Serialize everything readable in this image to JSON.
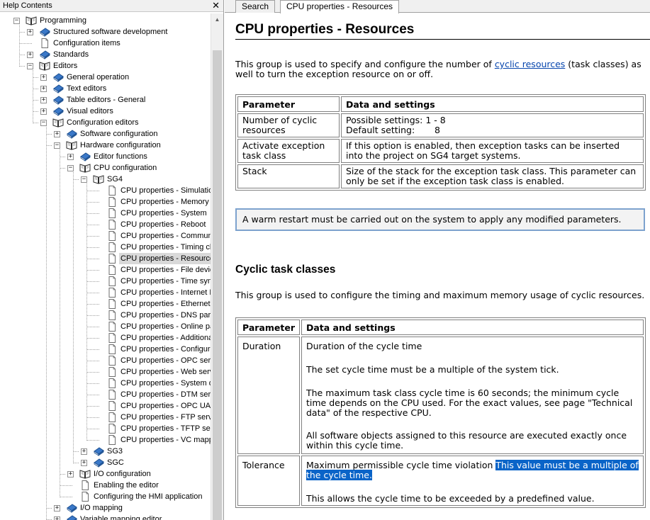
{
  "left_pane": {
    "title": "Help Contents",
    "close": "✕",
    "tree": [
      {
        "label": "Programming",
        "level": 0,
        "icon": "book-open-icon",
        "expander": "minus"
      },
      {
        "label": "Structured software development",
        "level": 1,
        "icon": "book-closed-icon",
        "expander": "plus"
      },
      {
        "label": "Configuration items",
        "level": 1,
        "icon": "page-icon",
        "expander": "none"
      },
      {
        "label": "Standards",
        "level": 1,
        "icon": "book-closed-icon",
        "expander": "plus"
      },
      {
        "label": "Editors",
        "level": 1,
        "icon": "book-open-icon",
        "expander": "minus"
      },
      {
        "label": "General operation",
        "level": 2,
        "icon": "book-closed-icon",
        "expander": "plus"
      },
      {
        "label": "Text editors",
        "level": 2,
        "icon": "book-closed-icon",
        "expander": "plus"
      },
      {
        "label": "Table editors - General",
        "level": 2,
        "icon": "book-closed-icon",
        "expander": "plus"
      },
      {
        "label": "Visual editors",
        "level": 2,
        "icon": "book-closed-icon",
        "expander": "plus"
      },
      {
        "label": "Configuration editors",
        "level": 2,
        "icon": "book-open-icon",
        "expander": "minus"
      },
      {
        "label": "Software configuration",
        "level": 3,
        "icon": "book-closed-icon",
        "expander": "plus"
      },
      {
        "label": "Hardware configuration",
        "level": 3,
        "icon": "book-open-icon",
        "expander": "minus"
      },
      {
        "label": "Editor functions",
        "level": 4,
        "icon": "book-closed-icon",
        "expander": "plus"
      },
      {
        "label": "CPU configuration",
        "level": 4,
        "icon": "book-open-icon",
        "expander": "minus"
      },
      {
        "label": "SG4",
        "level": 5,
        "icon": "book-open-icon",
        "expander": "minus"
      },
      {
        "label": "CPU properties - Simulation",
        "level": 6,
        "icon": "page-icon",
        "expander": "none"
      },
      {
        "label": "CPU properties - Memory",
        "level": 6,
        "icon": "page-icon",
        "expander": "none"
      },
      {
        "label": "CPU properties - System",
        "level": 6,
        "icon": "page-icon",
        "expander": "none"
      },
      {
        "label": "CPU properties - Reboot",
        "level": 6,
        "icon": "page-icon",
        "expander": "none"
      },
      {
        "label": "CPU properties - Communicatio",
        "level": 6,
        "icon": "page-icon",
        "expander": "none"
      },
      {
        "label": "CPU properties - Timing chara",
        "level": 6,
        "icon": "page-icon",
        "expander": "none"
      },
      {
        "label": "CPU properties - Resources",
        "level": 6,
        "icon": "page-icon",
        "expander": "none",
        "selected": true
      },
      {
        "label": "CPU properties - File devices",
        "level": 6,
        "icon": "page-icon",
        "expander": "none"
      },
      {
        "label": "CPU properties - Time synchro",
        "level": 6,
        "icon": "page-icon",
        "expander": "none"
      },
      {
        "label": "CPU properties - Internet File S",
        "level": 6,
        "icon": "page-icon",
        "expander": "none"
      },
      {
        "label": "CPU properties - Ethernet para",
        "level": 6,
        "icon": "page-icon",
        "expander": "none"
      },
      {
        "label": "CPU properties - DNS paramet",
        "level": 6,
        "icon": "page-icon",
        "expander": "none"
      },
      {
        "label": "CPU properties - Online param",
        "level": 6,
        "icon": "page-icon",
        "expander": "none"
      },
      {
        "label": "CPU properties - Additional har",
        "level": 6,
        "icon": "page-icon",
        "expander": "none"
      },
      {
        "label": "CPU properties - Configuration",
        "level": 6,
        "icon": "page-icon",
        "expander": "none"
      },
      {
        "label": "CPU properties - OPC server",
        "level": 6,
        "icon": "page-icon",
        "expander": "none"
      },
      {
        "label": "CPU properties - Web server",
        "level": 6,
        "icon": "page-icon",
        "expander": "none"
      },
      {
        "label": "CPU properties - System diagn",
        "level": 6,
        "icon": "page-icon",
        "expander": "none"
      },
      {
        "label": "CPU properties - DTM server",
        "level": 6,
        "icon": "page-icon",
        "expander": "none"
      },
      {
        "label": "CPU properties - OPC UA serv",
        "level": 6,
        "icon": "page-icon",
        "expander": "none"
      },
      {
        "label": "CPU properties - FTP server",
        "level": 6,
        "icon": "page-icon",
        "expander": "none"
      },
      {
        "label": "CPU properties - TFTP server",
        "level": 6,
        "icon": "page-icon",
        "expander": "none"
      },
      {
        "label": "CPU properties - VC mapping",
        "level": 6,
        "icon": "page-icon",
        "expander": "none"
      },
      {
        "label": "SG3",
        "level": 5,
        "icon": "book-closed-icon",
        "expander": "plus"
      },
      {
        "label": "SGC",
        "level": 5,
        "icon": "book-closed-icon",
        "expander": "plus"
      },
      {
        "label": "I/O configuration",
        "level": 4,
        "icon": "book-open-icon",
        "expander": "plus"
      },
      {
        "label": "Enabling the editor",
        "level": 4,
        "icon": "page-icon",
        "expander": "none"
      },
      {
        "label": "Configuring the HMI application",
        "level": 4,
        "icon": "page-icon",
        "expander": "none"
      },
      {
        "label": "I/O mapping",
        "level": 3,
        "icon": "book-closed-icon",
        "expander": "plus"
      },
      {
        "label": "Variable mapping editor",
        "level": 3,
        "icon": "book-closed-icon",
        "expander": "plus"
      }
    ]
  },
  "tabs": [
    {
      "label": "Search",
      "active": false
    },
    {
      "label": "CPU properties - Resources",
      "active": true
    }
  ],
  "page": {
    "title": "CPU properties - Resources",
    "intro_before_link": "This group is used to specify and configure the number of ",
    "intro_link": "cyclic resources",
    "intro_after_link": " (task classes) as well to turn the exception resource on or off.",
    "table1": {
      "headers": [
        "Parameter",
        "Data and settings"
      ],
      "rows": [
        {
          "param": "Number of cyclic resources",
          "lines": [
            "Possible settings: 1 - 8",
            "Default setting:       8"
          ]
        },
        {
          "param": "Activate exception task class",
          "lines": [
            "If this option is enabled, then exception tasks can be inserted into the project on SG4 target systems."
          ]
        },
        {
          "param": "Stack",
          "lines": [
            "Size of the stack for the exception task class. This parameter can only be set if the exception task class is enabled."
          ]
        }
      ]
    },
    "note": "A warm restart must be carried out on the system to apply any modified parameters.",
    "section2_title": "Cyclic task classes",
    "section2_intro": "This group is used to configure the timing and maximum memory usage of cyclic resources.",
    "table2": {
      "headers": [
        "Parameter",
        "Data and settings"
      ],
      "duration_param": "Duration",
      "duration_paras": [
        "Duration of the cycle time",
        "The set cycle time must be a multiple of the system tick.",
        "The maximum task class cycle time is 60 seconds; the minimum cycle time depends on the CPU used. For the exact values, see page \"Technical data\" of the respective CPU.",
        "All software objects assigned to this resource are executed exactly once within this cycle time."
      ],
      "tolerance_param": "Tolerance",
      "tolerance_text": "Maximum permissible cycle time violation ",
      "tolerance_highlight": "This value must be a multiple of the cycle time.",
      "tolerance_para2": "This allows the cycle time to be exceeded by a predefined value."
    }
  },
  "colors": {
    "link": "#0645ad",
    "selection_highlight": "#0a64c8",
    "note_border": "#7da2ce",
    "book_blue": "#3a78c8"
  }
}
